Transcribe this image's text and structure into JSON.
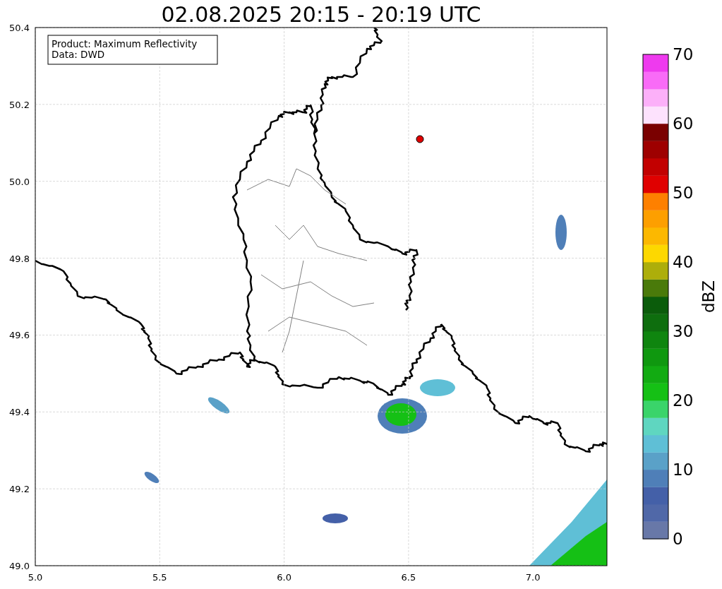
{
  "title": "02.08.2025 20:15 - 20:19 UTC",
  "legend": [
    "Product: Maximum Reflectivity",
    "Data: DWD"
  ],
  "x_ticks": [
    "5.0",
    "5.5",
    "6.0",
    "6.5",
    "7.0"
  ],
  "y_ticks": [
    "50.4",
    "50.2",
    "50.0",
    "49.8",
    "49.6",
    "49.4",
    "49.2",
    "49.0"
  ],
  "colorbar": {
    "label": "dBZ",
    "ticks": [
      "70",
      "60",
      "50",
      "40",
      "30",
      "20",
      "10",
      "0"
    ]
  }
}
